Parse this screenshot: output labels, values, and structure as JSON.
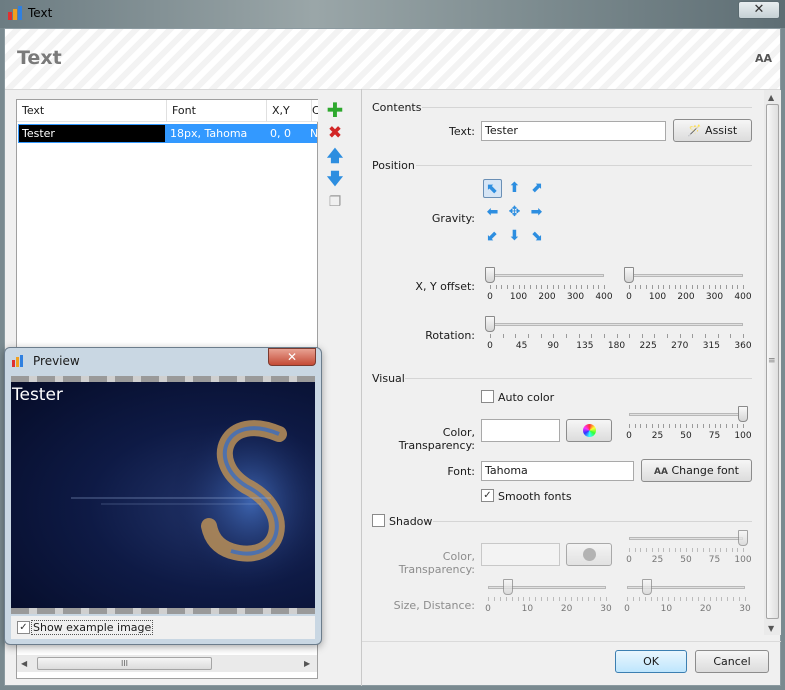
{
  "window": {
    "title": "Text",
    "close_glyph": "✕"
  },
  "header": {
    "title": "Text",
    "font_size_button": "AA"
  },
  "list": {
    "columns": [
      "Text",
      "Font",
      "X,Y",
      "C"
    ],
    "rows": [
      {
        "text": "Tester",
        "font": "18px, Tahoma",
        "xy": "0, 0",
        "extra": "N"
      }
    ],
    "scroll_grip": "III",
    "scroll_left": "◀",
    "scroll_right": "▶"
  },
  "side_buttons": {
    "add": "✚",
    "delete": "✖",
    "up": "🡅",
    "down": "🡇",
    "copy": "❐"
  },
  "contents": {
    "section": "Contents",
    "text_label": "Text:",
    "text_value": "Tester",
    "assist_button": "Assist"
  },
  "position": {
    "section": "Position",
    "gravity_label": "Gravity:",
    "gravity_glyphs": [
      "⬉",
      "⬆",
      "⬈",
      "⬅",
      "✥",
      "➡",
      "⬋",
      "⬇",
      "⬊"
    ],
    "offset_label": "X, Y offset:",
    "x_offset": {
      "value": 0,
      "ticks": [
        "0",
        "100",
        "200",
        "300",
        "400"
      ]
    },
    "y_offset": {
      "value": 0,
      "ticks": [
        "0",
        "100",
        "200",
        "300",
        "400"
      ]
    },
    "rotation_label": "Rotation:",
    "rotation": {
      "value": 0,
      "ticks": [
        "0",
        "45",
        "90",
        "135",
        "180",
        "225",
        "270",
        "315",
        "360"
      ]
    }
  },
  "visual": {
    "section": "Visual",
    "auto_color_label": "Auto color",
    "auto_color_checked": false,
    "color_label": "Color, Transparency:",
    "color_value": "#ffffff",
    "transparency": {
      "value": 100,
      "ticks": [
        "0",
        "25",
        "50",
        "75",
        "100"
      ]
    },
    "font_label": "Font:",
    "font_value": "Tahoma",
    "change_font_button": "Change font",
    "change_font_icon": "AA",
    "smooth_fonts_label": "Smooth fonts",
    "smooth_fonts_checked": true
  },
  "shadow": {
    "section": "Shadow",
    "enabled": false,
    "color_label": "Color, Transparency:",
    "transparency": {
      "value": 100,
      "ticks": [
        "0",
        "25",
        "50",
        "75",
        "100"
      ]
    },
    "size_distance_label": "Size, Distance:",
    "size": {
      "value": 5,
      "ticks": [
        "0",
        "10",
        "20",
        "30"
      ]
    },
    "distance": {
      "value": 5,
      "ticks": [
        "0",
        "10",
        "20",
        "30"
      ]
    }
  },
  "footer": {
    "ok_button": "OK",
    "cancel_button": "Cancel"
  },
  "preview": {
    "title": "Preview",
    "close_glyph": "✕",
    "overlay_text": "Tester",
    "show_example_label": "Show example image",
    "show_example_checked": true
  },
  "colors": {
    "selection": "#3399ff",
    "arrow_blue": "#2d8ee0",
    "add_green": "#2ea82e",
    "delete_red": "#d22626"
  }
}
